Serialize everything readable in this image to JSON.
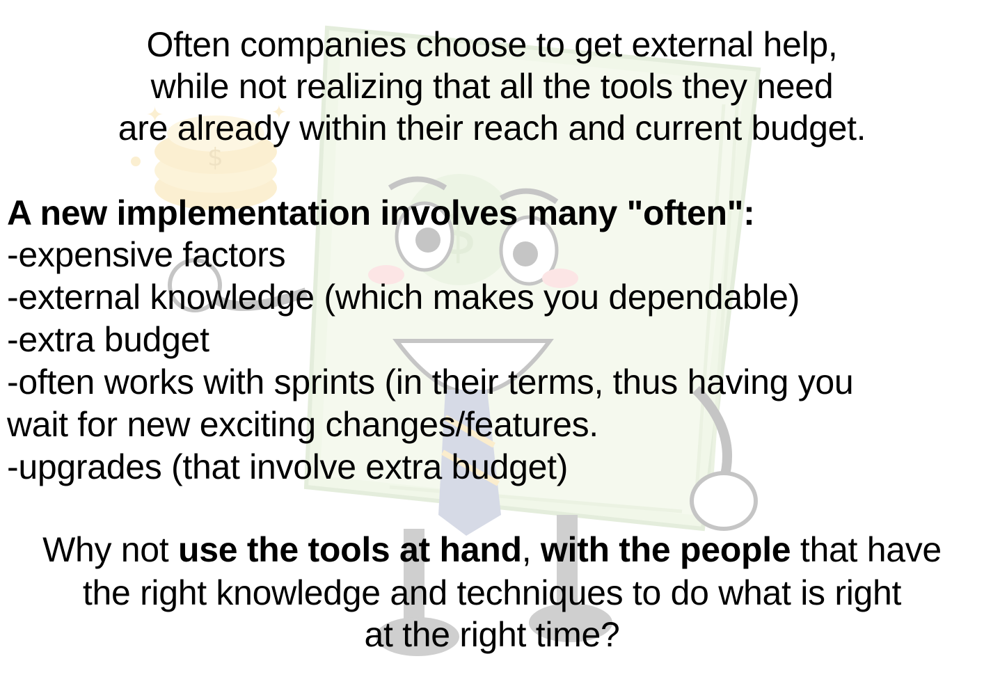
{
  "intro": {
    "lines": [
      "Often companies choose to get external help,",
      "while not realizing that all the tools they need",
      "are already within their reach and current budget."
    ]
  },
  "list": {
    "heading": "A new implementation involves many \"often\":",
    "items": [
      "-expensive factors",
      "-external knowledge (which makes you dependable)",
      "-extra budget",
      "-often works with sprints (in their terms, thus having you",
      "wait for new exciting changes/features.",
      "-upgrades (that involve extra budget)"
    ]
  },
  "closing": {
    "why_not": "Why not ",
    "tools_bold": "use the tools at hand",
    "comma": ", ",
    "people_bold": "with the people",
    "that_have": " that have",
    "line2": "the right knowledge and techniques to do what is right",
    "line3": "at the right time?"
  },
  "background": {
    "illustration": "money-stack-mascot-icon",
    "accent_color": "#e8f0dc"
  }
}
